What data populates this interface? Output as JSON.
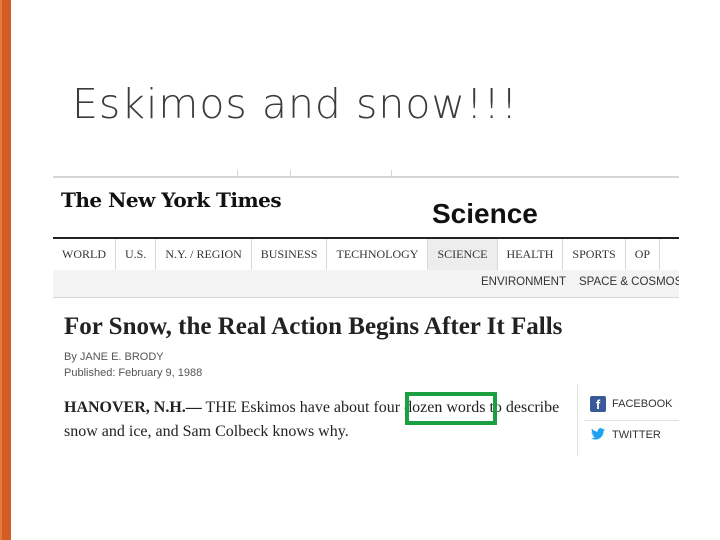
{
  "slide": {
    "title": "Eskimos and snow!!!",
    "accent_color": "#d35d27",
    "highlight_color": "#1aa040"
  },
  "screenshot": {
    "logo": "The New York Times",
    "section": "Science",
    "nav": [
      "WORLD",
      "U.S.",
      "N.Y. / REGION",
      "BUSINESS",
      "TECHNOLOGY",
      "SCIENCE",
      "HEALTH",
      "SPORTS",
      "OP"
    ],
    "active_nav": "SCIENCE",
    "subnav": [
      "ENVIRONMENT",
      "SPACE & COSMOS"
    ],
    "article": {
      "headline": "For Snow, the Real Action Begins After It Falls",
      "byline": "By JANE E. BRODY",
      "published": "Published: February 9, 1988",
      "dateline": "HANOVER, N.H.—",
      "text_before_highlight": " THE Eskimos have about ",
      "highlight": "four dozen",
      "text_after_highlight": " words to describe snow and ice, and Sam Colbeck knows why."
    },
    "share": {
      "facebook_label": "FACEBOOK",
      "twitter_label": "TWITTER",
      "facebook_icon": "facebook-icon",
      "twitter_icon": "twitter-icon"
    }
  }
}
